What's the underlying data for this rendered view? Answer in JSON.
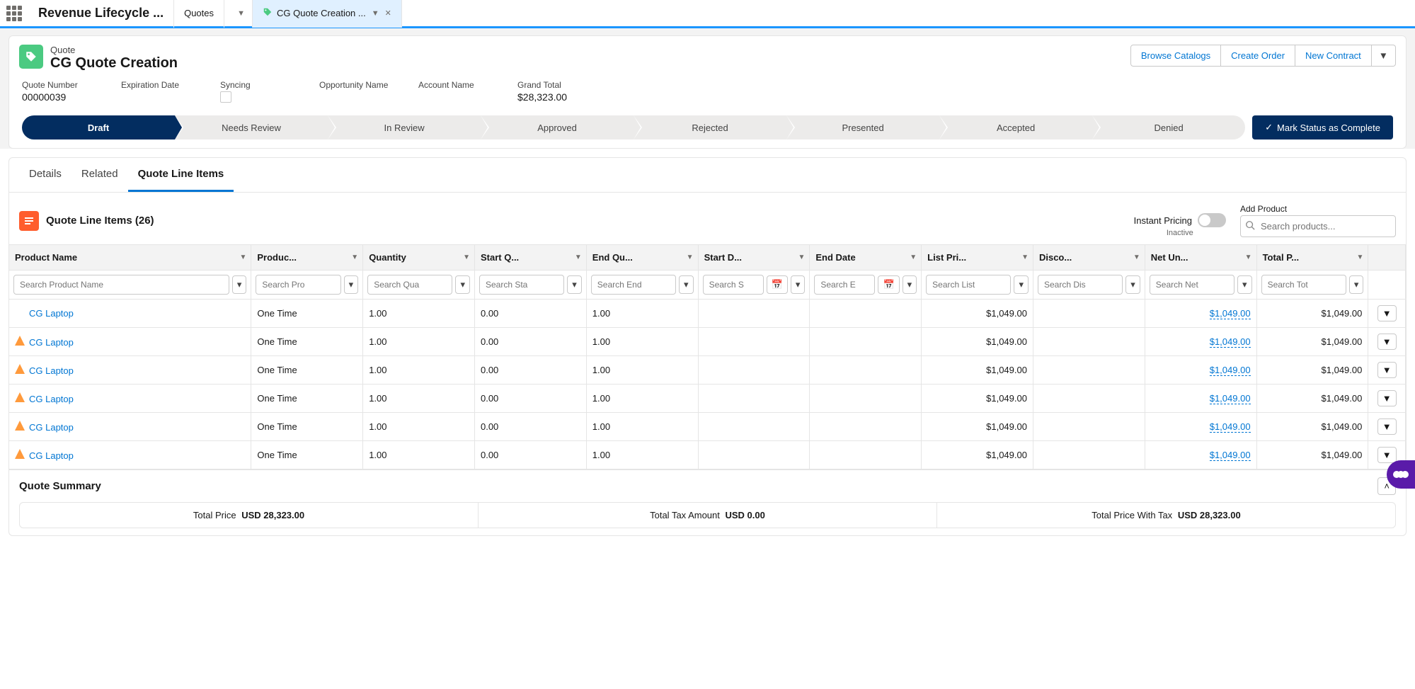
{
  "nav": {
    "app_name": "Revenue Lifecycle ...",
    "tab1_label": "Quotes",
    "tab2_label": "CG Quote Creation ..."
  },
  "header": {
    "object_label": "Quote",
    "title": "CG Quote Creation",
    "actions": {
      "browse": "Browse Catalogs",
      "create": "Create Order",
      "contract": "New Contract"
    },
    "fields": {
      "quote_number_label": "Quote Number",
      "quote_number_value": "00000039",
      "expiration_label": "Expiration Date",
      "expiration_value": "",
      "syncing_label": "Syncing",
      "opportunity_label": "Opportunity Name",
      "opportunity_value": "",
      "account_label": "Account Name",
      "account_value": "",
      "grand_total_label": "Grand Total",
      "grand_total_value": "$28,323.00"
    }
  },
  "path": {
    "stages": [
      "Draft",
      "Needs Review",
      "In Review",
      "Approved",
      "Rejected",
      "Presented",
      "Accepted",
      "Denied"
    ],
    "complete_label": "Mark Status as Complete"
  },
  "tabs": {
    "details": "Details",
    "related": "Related",
    "qli": "Quote Line Items"
  },
  "qli": {
    "title": "Quote Line Items (26)",
    "instant_label": "Instant Pricing",
    "instant_status": "Inactive",
    "add_label": "Add Product",
    "add_placeholder": "Search products...",
    "columns": [
      "Product Name",
      "Produc...",
      "Quantity",
      "Start Q...",
      "End Qu...",
      "Start D...",
      "End Date",
      "List Pri...",
      "Disco...",
      "Net Un...",
      "Total P..."
    ],
    "filters": {
      "product_name": "Search Product Name",
      "product_type": "Search Pro",
      "quantity": "Search Qua",
      "start_q": "Search Sta",
      "end_q": "Search End",
      "start_d": "Search S",
      "end_d": "Search E",
      "list_price": "Search List",
      "discount": "Search Dis",
      "net_unit": "Search Net",
      "total_price": "Search Tot"
    },
    "rows": [
      {
        "warn": false,
        "name": "CG Laptop",
        "ptype": "One Time",
        "qty": "1.00",
        "sq": "0.00",
        "eq": "1.00",
        "sd": "",
        "ed": "",
        "list": "$1,049.00",
        "disc": "",
        "net": "$1,049.00",
        "total": "$1,049.00"
      },
      {
        "warn": true,
        "name": "CG Laptop",
        "ptype": "One Time",
        "qty": "1.00",
        "sq": "0.00",
        "eq": "1.00",
        "sd": "",
        "ed": "",
        "list": "$1,049.00",
        "disc": "",
        "net": "$1,049.00",
        "total": "$1,049.00"
      },
      {
        "warn": true,
        "name": "CG Laptop",
        "ptype": "One Time",
        "qty": "1.00",
        "sq": "0.00",
        "eq": "1.00",
        "sd": "",
        "ed": "",
        "list": "$1,049.00",
        "disc": "",
        "net": "$1,049.00",
        "total": "$1,049.00"
      },
      {
        "warn": true,
        "name": "CG Laptop",
        "ptype": "One Time",
        "qty": "1.00",
        "sq": "0.00",
        "eq": "1.00",
        "sd": "",
        "ed": "",
        "list": "$1,049.00",
        "disc": "",
        "net": "$1,049.00",
        "total": "$1,049.00"
      },
      {
        "warn": true,
        "name": "CG Laptop",
        "ptype": "One Time",
        "qty": "1.00",
        "sq": "0.00",
        "eq": "1.00",
        "sd": "",
        "ed": "",
        "list": "$1,049.00",
        "disc": "",
        "net": "$1,049.00",
        "total": "$1,049.00"
      },
      {
        "warn": true,
        "name": "CG Laptop",
        "ptype": "One Time",
        "qty": "1.00",
        "sq": "0.00",
        "eq": "1.00",
        "sd": "",
        "ed": "",
        "list": "$1,049.00",
        "disc": "",
        "net": "$1,049.00",
        "total": "$1,049.00"
      }
    ]
  },
  "summary": {
    "title": "Quote Summary",
    "total_price_label": "Total Price",
    "total_price_value": "USD 28,323.00",
    "total_tax_label": "Total Tax Amount",
    "total_tax_value": "USD 0.00",
    "total_with_tax_label": "Total Price With Tax",
    "total_with_tax_value": "USD 28,323.00"
  }
}
